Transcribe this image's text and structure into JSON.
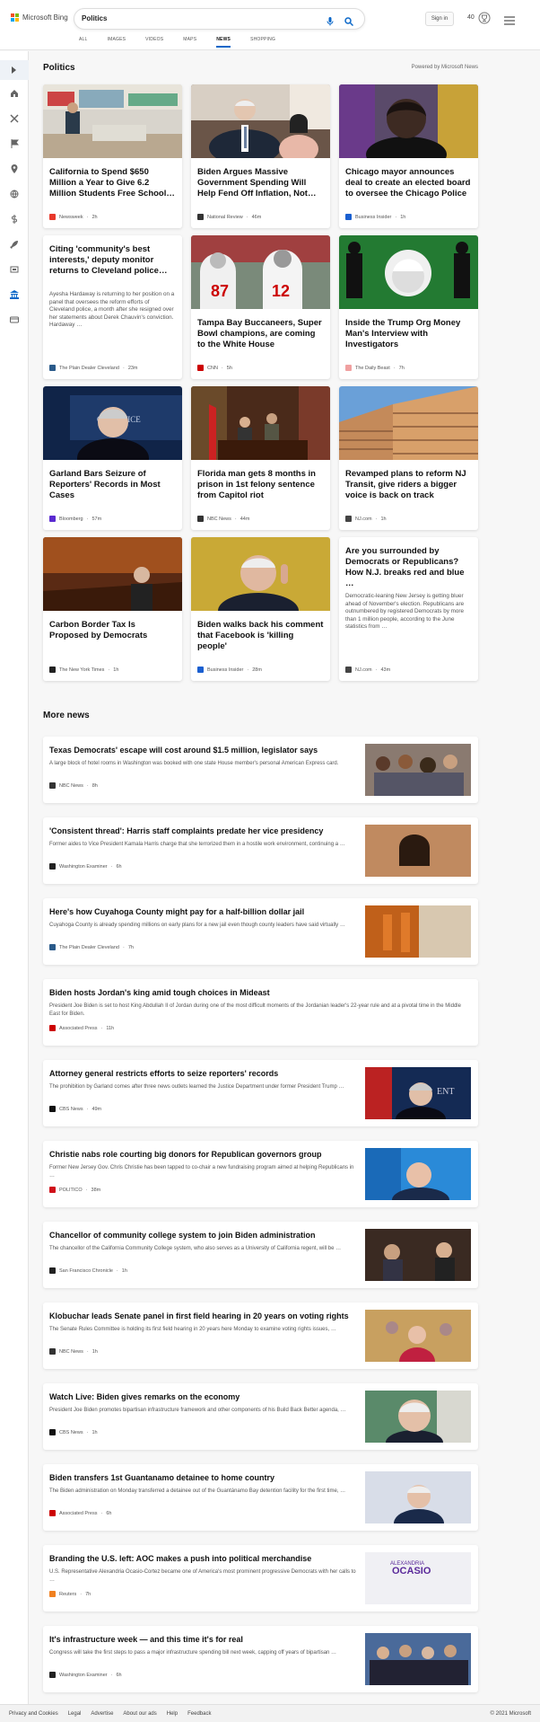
{
  "header": {
    "brand": "Microsoft Bing",
    "query": "Politics",
    "signin": "Sign in",
    "rewards": "40"
  },
  "tabs": [
    "ALL",
    "IMAGES",
    "VIDEOS",
    "MAPS",
    "NEWS",
    "SHOPPING"
  ],
  "section": {
    "title": "Politics",
    "powered": "Powered by Microsoft News"
  },
  "cards": [
    {
      "title": "California to Spend $650 Million a Year to Give 6.2 Million Students Free School…",
      "source": "Newsweek",
      "time": "2h",
      "color": "#e8382b"
    },
    {
      "title": "Biden Argues Massive Government Spending Will Help Fend Off Inflation, Not…",
      "source": "National Review",
      "time": "46m",
      "color": "#333"
    },
    {
      "title": "Chicago mayor announces deal to create an elected board to oversee the Chicago Police",
      "source": "Business Insider",
      "time": "1h",
      "color": "#1a5fd0"
    },
    {
      "title": "Citing 'community's best interests,' deputy monitor returns to Cleveland police…",
      "snippet": "Ayesha Hardaway is returning to her position on a panel that oversees the reform efforts of Cleveland police, a month after she resigned over her statements about Derek Chauvin's conviction. Hardaway …",
      "source": "The Plain Dealer Cleveland",
      "time": "23m",
      "color": "#2a5a8a"
    },
    {
      "title": "Tampa Bay Buccaneers, Super Bowl champions, are coming to the White House",
      "source": "CNN",
      "time": "5h",
      "color": "#cc0000"
    },
    {
      "title": "Inside the Trump Org Money Man's Interview with Investigators",
      "source": "The Daily Beast",
      "time": "7h",
      "color": "#f0a0a0"
    },
    {
      "title": "Garland Bars Seizure of Reporters' Records in Most Cases",
      "source": "Bloomberg",
      "time": "57m",
      "color": "#5a2ad0"
    },
    {
      "title": "Florida man gets 8 months in prison in 1st felony sentence from Capitol riot",
      "source": "NBC News",
      "time": "44m",
      "color": "#333"
    },
    {
      "title": "Revamped plans to reform NJ Transit, give riders a bigger voice is back on track",
      "source": "NJ.com",
      "time": "1h",
      "color": "#444"
    },
    {
      "title": "Carbon Border Tax Is Proposed by Democrats",
      "source": "The New York Times",
      "time": "1h",
      "color": "#222"
    },
    {
      "title": "Biden walks back his comment that Facebook is 'killing people'",
      "source": "Business Insider",
      "time": "28m",
      "color": "#1a5fd0"
    },
    {
      "title": "Are you surrounded by Democrats or Republicans? How N.J. breaks red and blue …",
      "snippet": "Democratic-leaning New Jersey is getting bluer ahead of November's election. Republicans are outnumbered by registered Democrats by more than 1 million people, according to the June statistics from …",
      "source": "NJ.com",
      "time": "43m",
      "color": "#444"
    }
  ],
  "more": {
    "title": "More news"
  },
  "rows": [
    {
      "title": "Texas Democrats' escape will cost around $1.5 million, legislator says",
      "snippet": "A large block of hotel rooms in Washington was booked with one state House member's personal American Express card.",
      "source": "NBC News",
      "time": "8h",
      "color": "#333"
    },
    {
      "title": "'Consistent thread': Harris staff complaints predate her vice presidency",
      "snippet": "Former aides to Vice President Kamala Harris charge that she terrorized them in a hostile work environment, continuing a …",
      "source": "Washington Examiner",
      "time": "6h",
      "color": "#222"
    },
    {
      "title": "Here's how Cuyahoga County might pay for a half-billion dollar jail",
      "snippet": "Cuyahoga County is already spending millions on early plans for a new jail even though county leaders have said virtually …",
      "source": "The Plain Dealer Cleveland",
      "time": "7h",
      "color": "#2a5a8a"
    },
    {
      "title": "Biden hosts Jordan's king amid tough choices in Mideast",
      "snippet": "President Joe Biden is set to host King Abdullah II of Jordan during one of the most difficult moments of the Jordanian leader's 22-year rule and at a pivotal time in the Middle East for Biden.",
      "source": "Associated Press",
      "time": "11h",
      "color": "#cc0000"
    },
    {
      "title": "Attorney general restricts efforts to seize reporters' records",
      "snippet": "The prohibition by Garland comes after three news outlets learned the Justice Department under former President Trump …",
      "source": "CBS News",
      "time": "49m",
      "color": "#111"
    },
    {
      "title": "Christie nabs role courting big donors for Republican governors group",
      "snippet": "Former New Jersey Gov. Chris Christie has been tapped to co-chair a new fundraising program aimed at helping Republicans in …",
      "source": "POLITICO",
      "time": "38m",
      "color": "#d0101a"
    },
    {
      "title": "Chancellor of community college system to join Biden administration",
      "snippet": "The chancellor of the California Community College system, who also serves as a University of California regent, will be …",
      "source": "San Francisco Chronicle",
      "time": "1h",
      "color": "#222"
    },
    {
      "title": "Klobuchar leads Senate panel in first field hearing in 20 years on voting rights",
      "snippet": "The Senate Rules Committee is holding its first field hearing in 20 years here Monday to examine voting rights issues, …",
      "source": "NBC News",
      "time": "1h",
      "color": "#333"
    },
    {
      "title": "Watch Live: Biden gives remarks on the economy",
      "snippet": "President Joe Biden promotes bipartisan infrastructure framework and other components of his Build Back Better agenda, …",
      "source": "CBS News",
      "time": "1h",
      "color": "#111"
    },
    {
      "title": "Biden transfers 1st Guantanamo detainee to home country",
      "snippet": "The Biden administration on Monday transferred a detainee out of the Guantánamo Bay detention facility for the first time, …",
      "source": "Associated Press",
      "time": "6h",
      "color": "#cc0000"
    },
    {
      "title": "Branding the U.S. left: AOC makes a push into political merchandise",
      "snippet": "U.S. Representative Alexandria Ocasio-Cortez became one of America's most prominent progressive Democrats with her calls to …",
      "source": "Reuters",
      "time": "7h",
      "color": "#f08020"
    },
    {
      "title": "It's infrastructure week — and this time it's for real",
      "snippet": "Congress will take the first steps to pass a major infrastructure spending bill next week, capping off years of bipartisan …",
      "source": "Washington Examiner",
      "time": "6h",
      "color": "#222"
    }
  ],
  "footer": {
    "links": [
      "Privacy and Cookies",
      "Legal",
      "Advertise",
      "About our ads",
      "Help",
      "Feedback"
    ],
    "copyright": "© 2021 Microsoft"
  }
}
